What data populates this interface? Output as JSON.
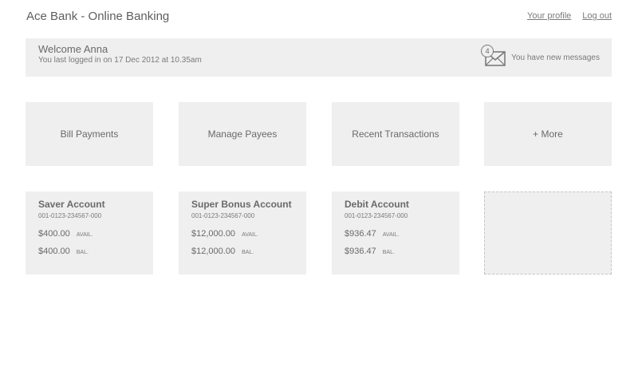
{
  "header": {
    "app_title": "Ace Bank - Online Banking",
    "profile_link": "Your profile",
    "logout_link": "Log out"
  },
  "welcome": {
    "title": "Welcome Anna",
    "last_login": "You last logged in on 17 Dec 2012 at 10.35am",
    "message_count": "4",
    "message_text": "You have new messages",
    "message_icon": "envelope-icon"
  },
  "tiles": [
    {
      "label": "Bill Payments"
    },
    {
      "label": "Manage Payees"
    },
    {
      "label": "Recent Transactions"
    },
    {
      "label": "+ More"
    }
  ],
  "accounts": [
    {
      "name": "Saver Account",
      "number": "001-0123-234567-000",
      "available": "$400.00",
      "available_label": "AVAIL.",
      "balance": "$400.00",
      "balance_label": "BAL."
    },
    {
      "name": "Super Bonus Account",
      "number": "001-0123-234567-000",
      "available": "$12,000.00",
      "available_label": "AVAIL.",
      "balance": "$12,000.00",
      "balance_label": "BAL."
    },
    {
      "name": "Debit Account",
      "number": "001-0123-234567-000",
      "available": "$936.47",
      "available_label": "AVAIL.",
      "balance": "$936.47",
      "balance_label": "BAL."
    }
  ],
  "colors": {
    "panel": "#efeff0",
    "text": "#6a6a6a",
    "muted_text": "#7a7a7a",
    "dashed_border": "#c4c4c4"
  }
}
